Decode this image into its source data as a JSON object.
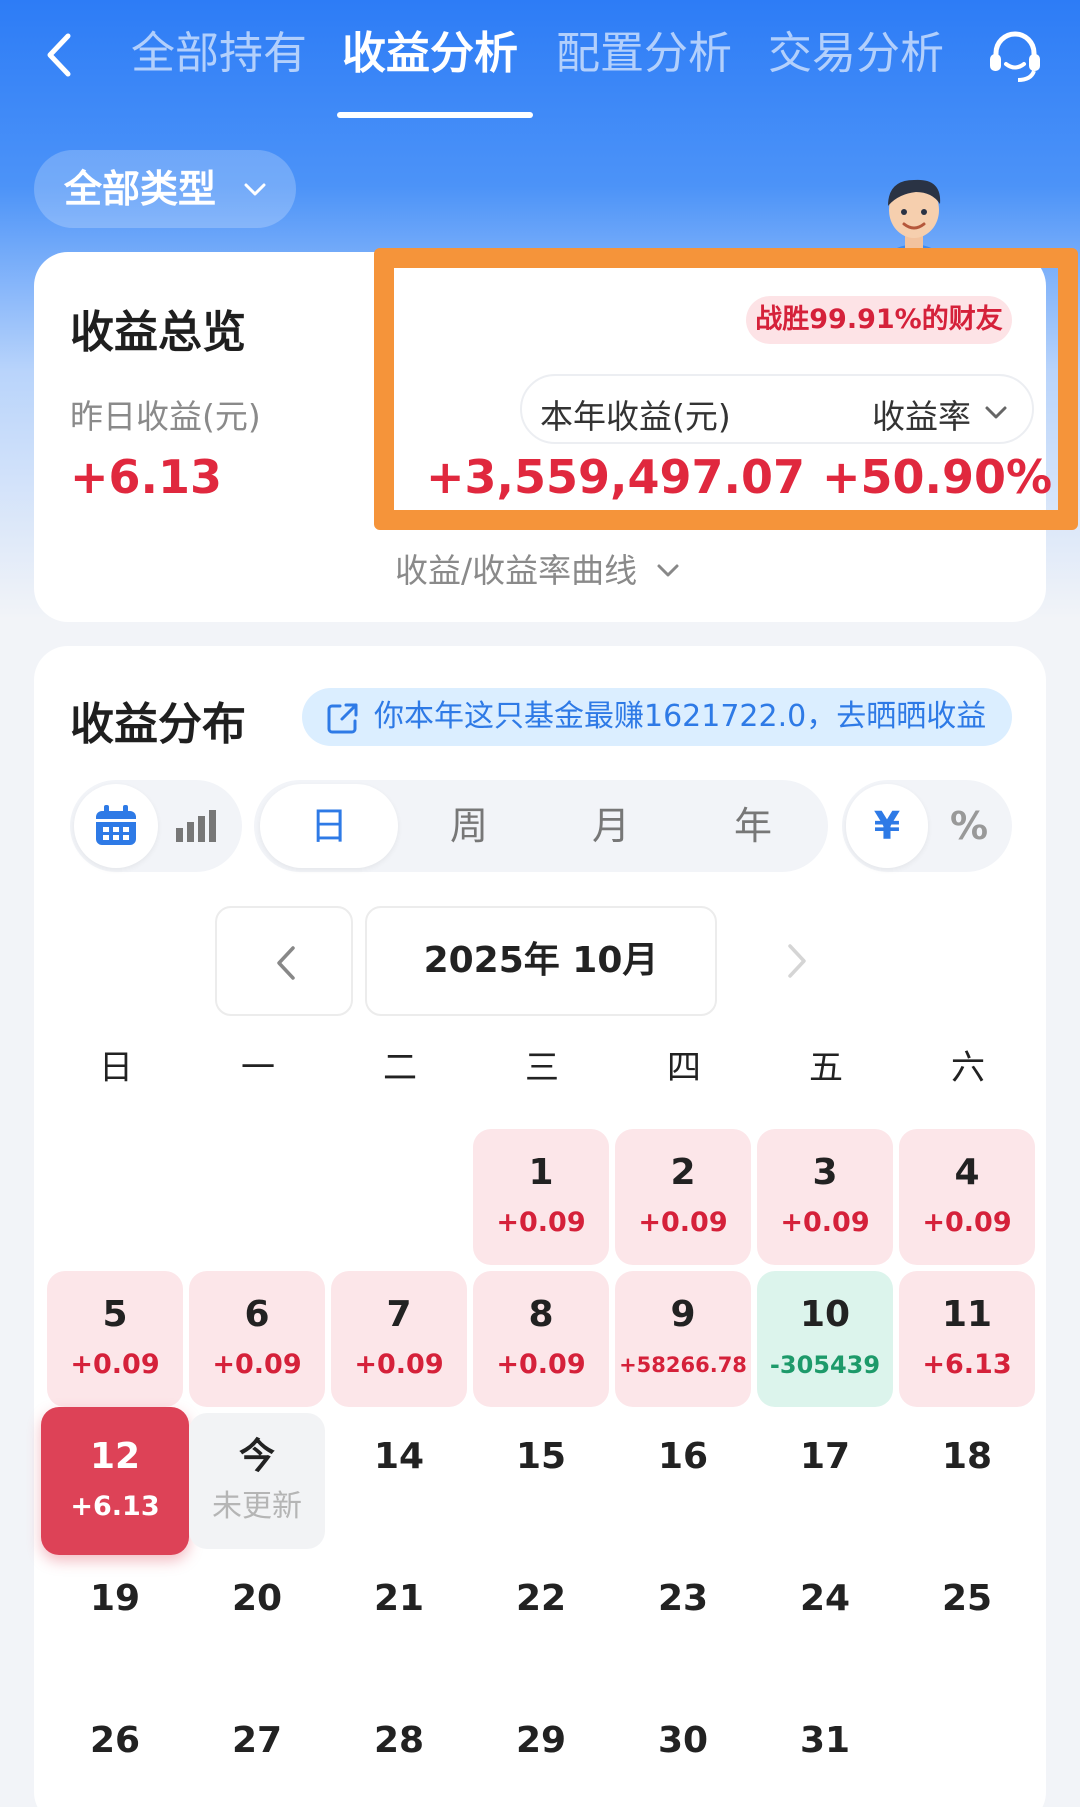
{
  "header": {
    "tabs": [
      "全部持有",
      "收益分析",
      "配置分析",
      "交易分析"
    ],
    "active_tab": "收益分析"
  },
  "filter": {
    "type_label": "全部类型"
  },
  "overview": {
    "title": "收益总览",
    "yesterday_label": "昨日收益(元)",
    "yesterday_value": "+6.13",
    "beat_badge": "战胜99.91%的财友",
    "year_label": "本年收益(元)",
    "rate_label": "收益率",
    "year_value": "+3,559,497.07",
    "rate_value": "+50.90%",
    "curve_link": "收益/收益率曲线"
  },
  "distribution": {
    "title": "收益分布",
    "share_text": "你本年这只基金最赚1621722.0，去晒晒收益",
    "periods": [
      "日",
      "周",
      "月",
      "年"
    ],
    "active_period": "日",
    "units": [
      "¥",
      "%"
    ],
    "active_unit": "¥",
    "month_label": "2025年 10月",
    "weekdays": [
      "日",
      "一",
      "二",
      "三",
      "四",
      "五",
      "六"
    ],
    "days": [
      {
        "n": "1",
        "v": "+0.09"
      },
      {
        "n": "2",
        "v": "+0.09"
      },
      {
        "n": "3",
        "v": "+0.09"
      },
      {
        "n": "4",
        "v": "+0.09"
      },
      {
        "n": "5",
        "v": "+0.09"
      },
      {
        "n": "6",
        "v": "+0.09"
      },
      {
        "n": "7",
        "v": "+0.09"
      },
      {
        "n": "8",
        "v": "+0.09"
      },
      {
        "n": "9",
        "v": "+58266.78"
      },
      {
        "n": "10",
        "v": "-305439"
      },
      {
        "n": "11",
        "v": "+6.13"
      },
      {
        "n": "12",
        "v": "+6.13"
      },
      {
        "n": "今",
        "v": "未更新"
      },
      {
        "n": "14",
        "v": ""
      },
      {
        "n": "15",
        "v": ""
      },
      {
        "n": "16",
        "v": ""
      },
      {
        "n": "17",
        "v": ""
      },
      {
        "n": "18",
        "v": ""
      },
      {
        "n": "19",
        "v": ""
      },
      {
        "n": "20",
        "v": ""
      },
      {
        "n": "21",
        "v": ""
      },
      {
        "n": "22",
        "v": ""
      },
      {
        "n": "23",
        "v": ""
      },
      {
        "n": "24",
        "v": ""
      },
      {
        "n": "25",
        "v": ""
      },
      {
        "n": "26",
        "v": ""
      },
      {
        "n": "27",
        "v": ""
      },
      {
        "n": "28",
        "v": ""
      },
      {
        "n": "29",
        "v": ""
      },
      {
        "n": "30",
        "v": ""
      },
      {
        "n": "31",
        "v": ""
      }
    ]
  },
  "colors": {
    "brand_blue": "#2e7ae6",
    "gain_red": "#e0283e",
    "loss_green": "#1d9a6a",
    "highlight_orange": "#f5943a",
    "selected_day": "#dd4257"
  }
}
